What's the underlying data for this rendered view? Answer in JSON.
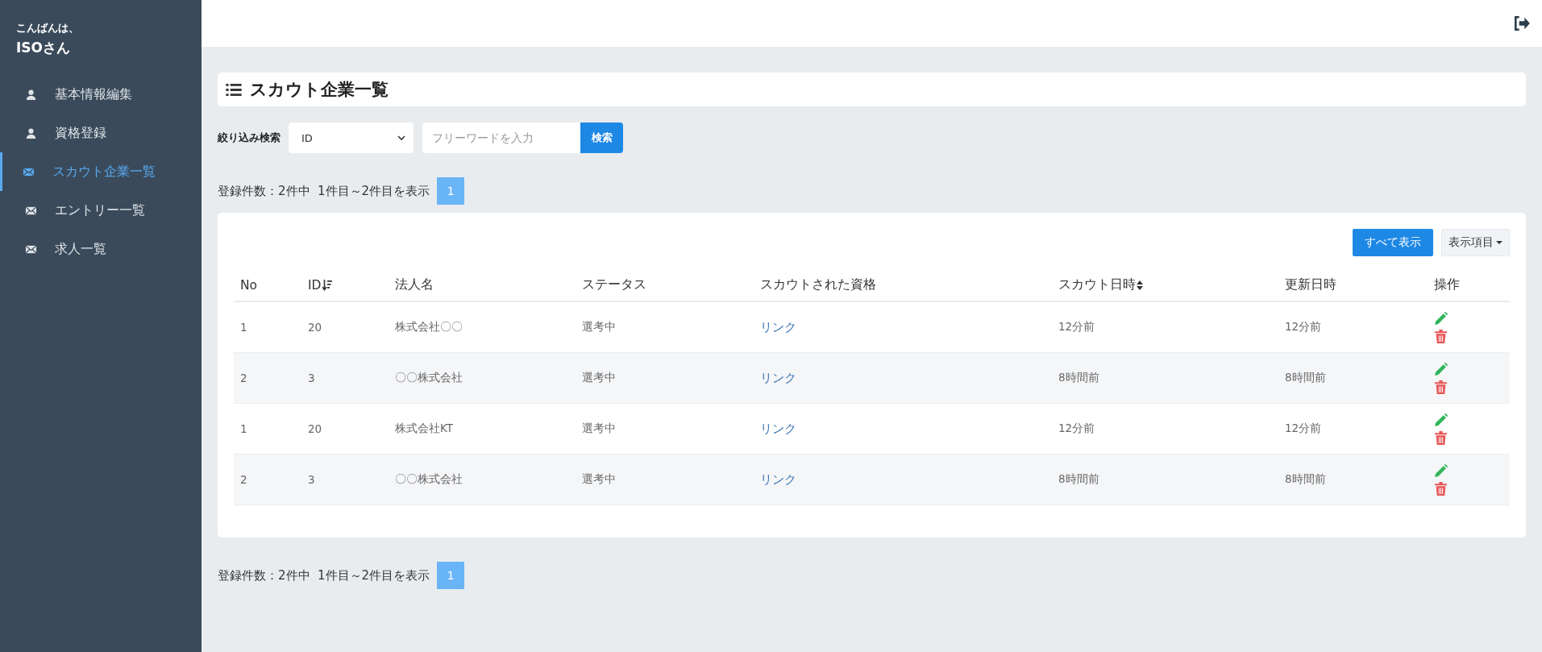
{
  "sidebar": {
    "greeting": "こんばんは、",
    "user_name": "ISOさん",
    "items": [
      {
        "label": "基本情報編集",
        "kind": "profile",
        "selected": false
      },
      {
        "label": "資格登録",
        "kind": "profile",
        "selected": false
      },
      {
        "label": "スカウト企業一覧",
        "kind": "message",
        "selected": true
      },
      {
        "label": "エントリー一覧",
        "kind": "message",
        "selected": false
      },
      {
        "label": "求人一覧",
        "kind": "message",
        "selected": false
      }
    ]
  },
  "page_title": "スカウト企業一覧",
  "filter": {
    "label": "絞り込み検索",
    "select_value": "ID",
    "placeholder": "フリーワードを入力",
    "button": "検索"
  },
  "pagination_top": {
    "summary": "登録件数：2件中  1件目～2件目を表示",
    "pages": [
      {
        "label": "1",
        "selected": true
      }
    ]
  },
  "table": {
    "show_all_button": "すべて表示",
    "columns_button": "表示項目",
    "columns": [
      {
        "label": "No"
      },
      {
        "label": "ID"
      },
      {
        "label": "法人名"
      },
      {
        "label": "ステータス"
      },
      {
        "label": "スカウトされた資格"
      },
      {
        "label": "スカウト日時"
      },
      {
        "label": "更新日時"
      },
      {
        "label": "操作"
      }
    ],
    "rows": [
      {
        "no": "1",
        "id": "20",
        "company": "株式会社〇〇",
        "status": "選考中",
        "qualification": "リンク",
        "scouted": "12分前",
        "updated": "12分前"
      },
      {
        "no": "2",
        "id": "3",
        "company": "〇〇株式会社",
        "status": "選考中",
        "qualification": "リンク",
        "scouted": "8時間前",
        "updated": "8時間前"
      },
      {
        "no": "1",
        "id": "20",
        "company": "株式会社KT",
        "status": "選考中",
        "qualification": "リンク",
        "scouted": "12分前",
        "updated": "12分前"
      },
      {
        "no": "2",
        "id": "3",
        "company": "〇〇株式会社",
        "status": "選考中",
        "qualification": "リンク",
        "scouted": "8時間前",
        "updated": "8時間前"
      }
    ]
  },
  "pagination_bottom": {
    "summary": "登録件数：2件中  1件目～2件目を表示",
    "pages": [
      {
        "label": "1",
        "selected": true
      }
    ]
  }
}
